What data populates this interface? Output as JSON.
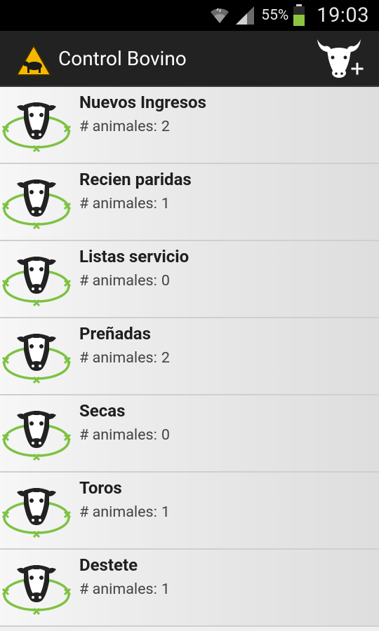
{
  "status_bar": {
    "battery_percent": "55%",
    "time": "19:03",
    "icons": [
      "wifi-icon",
      "signal-icon",
      "battery-icon"
    ],
    "battery_color": "#8cc63f"
  },
  "action_bar": {
    "title": "Control Bovino",
    "logo_icon": "cattle-warning-sign-icon",
    "add_button_icon": "bull-add-icon",
    "logo_color": "#f5b800"
  },
  "groups": [
    {
      "name": "Nuevos Ingresos",
      "count_label": "# animales:",
      "count": "2"
    },
    {
      "name": "Recien paridas",
      "count_label": "# animales:",
      "count": "1"
    },
    {
      "name": "Listas servicio",
      "count_label": "# animales:",
      "count": "0"
    },
    {
      "name": "Preñadas",
      "count_label": "# animales:",
      "count": "2"
    },
    {
      "name": "Secas",
      "count_label": "# animales:",
      "count": "0"
    },
    {
      "name": "Toros",
      "count_label": "# animales:",
      "count": "1"
    },
    {
      "name": "Destete",
      "count_label": "# animales:",
      "count": "1"
    }
  ],
  "row_icon": "cow-fence-icon",
  "row_icon_accent": "#7dc242"
}
